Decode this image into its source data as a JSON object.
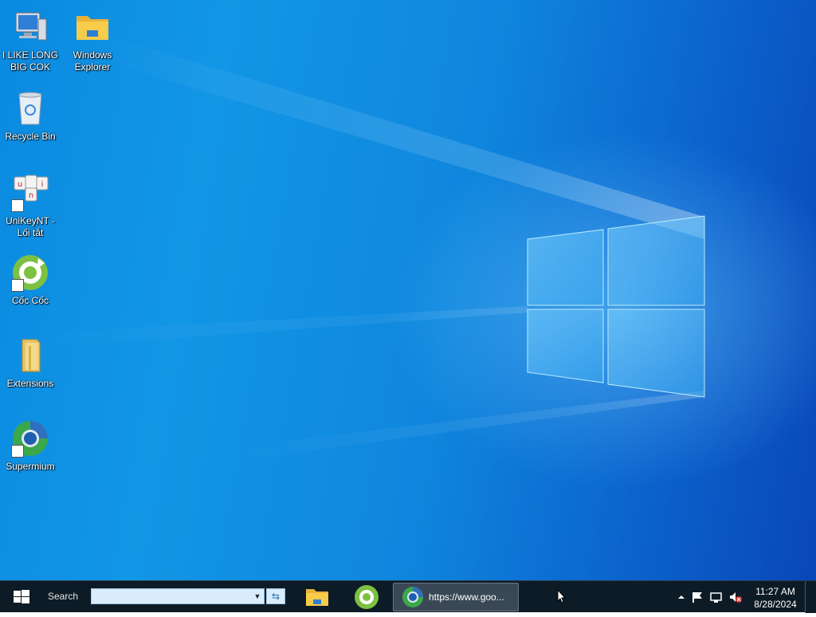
{
  "desktop": {
    "icons": [
      {
        "label": "I LIKE LONG BIG COK",
        "icon": "computer-icon"
      },
      {
        "label": "Windows Explorer",
        "icon": "folder-icon"
      },
      {
        "label": "Recycle Bin",
        "icon": "recycle-bin-icon"
      },
      {
        "label": "UniKeyNT - Lối tắt",
        "icon": "unikey-icon"
      },
      {
        "label": "Cốc Cốc",
        "icon": "coccoc-icon"
      },
      {
        "label": "Extensions",
        "icon": "folder-icon"
      },
      {
        "label": "Supermium",
        "icon": "supermium-icon"
      }
    ]
  },
  "taskbar": {
    "start_icon": "windows-logo-icon",
    "search_label": "Search",
    "search_value": "",
    "pinned": [
      {
        "name": "file-explorer",
        "icon": "folder-icon"
      },
      {
        "name": "coc-coc",
        "icon": "coccoc-icon"
      }
    ],
    "active_window": {
      "title": "https://www.goo...",
      "icon": "supermium-icon"
    },
    "tray": {
      "icons": [
        "chevron-up-icon",
        "flag-icon",
        "network-icon",
        "volume-muted-icon"
      ]
    },
    "clock": {
      "time": "11:27 AM",
      "date": "8/28/2024"
    }
  },
  "colors": {
    "wallpaper_blue": "#0f86dd",
    "taskbar": "#0d1b26",
    "search_box": "#d9ecfb"
  }
}
